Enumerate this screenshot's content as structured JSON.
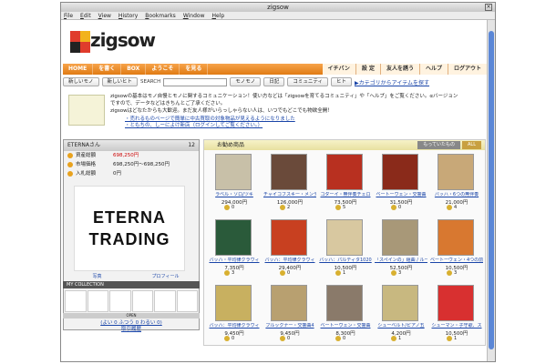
{
  "window": {
    "title": "zigsow"
  },
  "menu": [
    "File",
    "Edit",
    "View",
    "History",
    "Bookmarks",
    "Window",
    "Help"
  ],
  "logo": {
    "text": "zigsow"
  },
  "nav": {
    "left": [
      "HOME",
      "を書く",
      "BOX",
      "ようこそ",
      "を見る"
    ],
    "right": [
      "イチバン",
      "設 定",
      "友人を誘う",
      "ヘルプ",
      "ログアウト"
    ]
  },
  "toolbar": {
    "btn1": "新しいモノ",
    "btn2": "新しいヒト",
    "search_label": "SEARCH",
    "btn3": "モノモノ",
    "btn4": "日記",
    "btn5": "コミュニティ",
    "btn6": "ヒト",
    "category_link": "▶カテゴリからアイテムを探す"
  },
  "info": {
    "line1": "zigsowの基本はモノ自慢とモノに関するコミュニケーション！使い方などは「zigsowを育てるコミュニティ」や「ヘルプ」をご覧ください。αバージョン",
    "line2": "ですので、データなどはきちんとご了承ください。",
    "line3": "zigsowはどなたからも大歓迎。まだ友人様がいらっしゃらない人は、いつでもどこでも物欲全開！",
    "bullet1": "・売れるものページで簡単に中古買取の対象物品が見えるようになりました",
    "bullet2": "・ともちの、しーによけ新店（ログインしてご覧ください。）"
  },
  "sidebar": {
    "user": "ETERNAさん",
    "count": "12",
    "rows": [
      {
        "label": "資産総額",
        "value": "698,250円"
      },
      {
        "label": "市場価格",
        "value": "698,250円～698,250円"
      },
      {
        "label": "入札総額",
        "value": "0円"
      }
    ],
    "logo_line1": "ETERNA",
    "logo_line2": "TRADING",
    "tab1": "写真",
    "tab2": "プロフィール",
    "collection": "MY COLLECTION",
    "open": "OPEN",
    "footer": "(よい 0 ふつう 0 わるい 0)",
    "footer2": "取引履歴"
  },
  "products": {
    "header": "お勧め商品",
    "tab_active": "もっていたもの",
    "tab_all": "ALL",
    "items": [
      {
        "title": "ラベル・ソロ/ツキ",
        "price": "294,000円",
        "count": "0",
        "color": "#c8c0a8"
      },
      {
        "title": "チャイコフスキー・メンデルス",
        "price": "126,000円",
        "count": "2",
        "color": "#6a4a3a"
      },
      {
        "title": "コダーイ・無伴奏チェロ",
        "price": "73,500円",
        "count": "5",
        "color": "#b83020"
      },
      {
        "title": "ベートーヴェン・交響曲",
        "price": "31,500円",
        "count": "0",
        "color": "#8a2a1a"
      },
      {
        "title": "バッハ・6つの無伴奏",
        "price": "21,000円",
        "count": "4",
        "color": "#c8a878"
      },
      {
        "title": "バッハ・平均律クラヴィ",
        "price": "7,350円",
        "count": "3",
        "color": "#2a5a3a"
      },
      {
        "title": "バッハ：平均律クラヴィ",
        "price": "29,400円",
        "count": "0",
        "color": "#c84020"
      },
      {
        "title": "バッハ：パルティタ1020",
        "price": "10,500円",
        "count": "1",
        "color": "#d8c8a0"
      },
      {
        "title": "「スペインの」組曲 / ルーセル",
        "price": "52,500円",
        "count": "3",
        "color": "#a89878"
      },
      {
        "title": "ベートーヴェン・4つの前",
        "price": "10,500円",
        "count": "3",
        "color": "#d87830"
      },
      {
        "title": "バッハ：平均律クラヴィ",
        "price": "9,450円",
        "count": "0",
        "color": "#c8b060"
      },
      {
        "title": "ブルックナー・交響曲4",
        "price": "9,450円",
        "count": "0",
        "color": "#b8a070"
      },
      {
        "title": "ベートーヴェン・交響曲",
        "price": "8,300円",
        "count": "0",
        "color": "#8a7a6a"
      },
      {
        "title": "シューベルト/ピアノ五",
        "price": "4,200円",
        "count": "1",
        "color": "#c8b880"
      },
      {
        "title": "シューマン・子守歌、ス",
        "price": "10,500円",
        "count": "1",
        "color": "#d83030"
      }
    ]
  }
}
